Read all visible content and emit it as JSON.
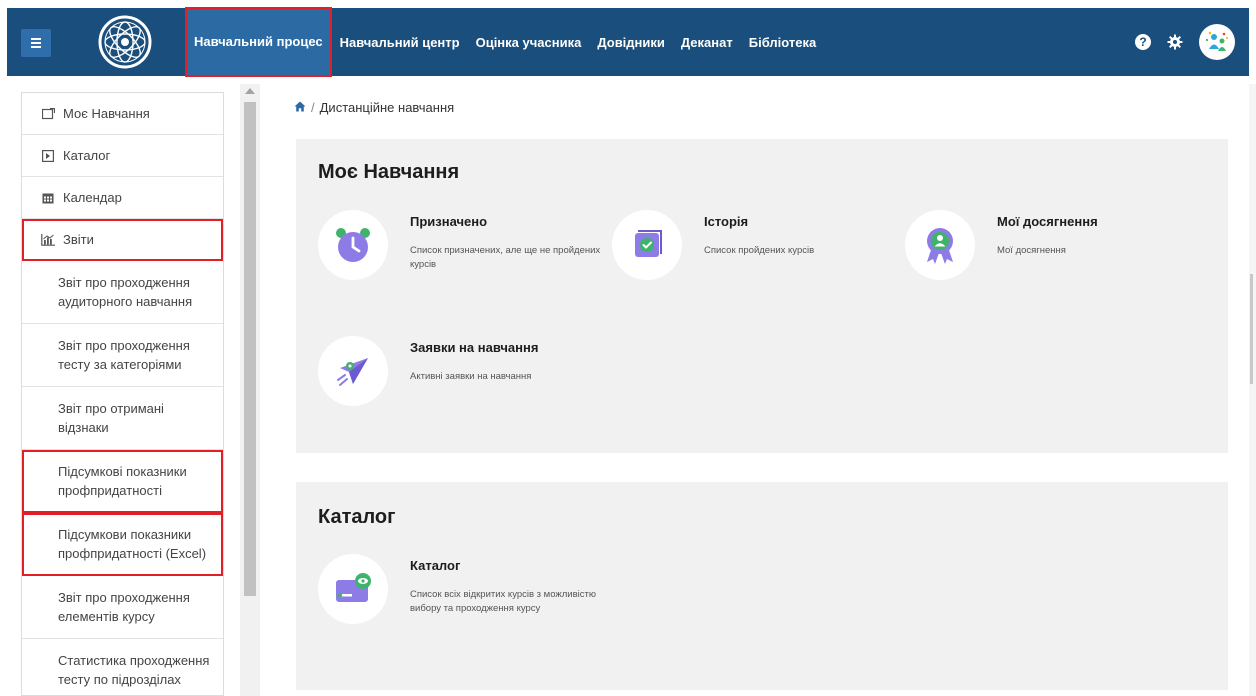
{
  "navbar": {
    "items": [
      {
        "label": "Навчальний процес",
        "active": true
      },
      {
        "label": "Навчальний центр"
      },
      {
        "label": "Оцінка учасника"
      },
      {
        "label": "Довідники"
      },
      {
        "label": "Деканат"
      },
      {
        "label": "Бібліотека"
      }
    ],
    "help_symbol": "?",
    "brand_color": "#1a4e7c",
    "highlight_color": "#e01f26"
  },
  "sidebar": {
    "items": [
      {
        "label": "Моє Навчання",
        "icon": "course-icon"
      },
      {
        "label": "Каталог",
        "icon": "catalog-icon"
      },
      {
        "label": "Календар",
        "icon": "calendar-icon"
      },
      {
        "label": "Звіти",
        "icon": "chart-icon",
        "highlighted": true
      }
    ],
    "subitems": [
      {
        "label": "Звіт про проходження аудиторного навчання"
      },
      {
        "label": "Звіт про проходження тесту за категоріями"
      },
      {
        "label": "Звіт про отримані відзнаки"
      },
      {
        "label": "Підсумкові показники профпридатності",
        "highlighted": true
      },
      {
        "label": "Підсумкови показники профпридатності (Excel)",
        "highlighted": true
      },
      {
        "label": "Звіт про проходження елементів курсу"
      },
      {
        "label": "Статистика проходження тесту по підрозділах"
      }
    ]
  },
  "breadcrumb": {
    "separator": "/",
    "current": "Дистанційне навчання"
  },
  "sections": {
    "my_learning": {
      "title": "Моє Навчання",
      "cards": [
        {
          "title": "Призначено",
          "desc": "Список призначених, але ще не пройдених курсів",
          "icon": "alarm-clock-icon"
        },
        {
          "title": "Історія",
          "desc": "Список пройдених курсів",
          "icon": "checkbox-icon"
        },
        {
          "title": "Мої досягнення",
          "desc": "Мої досягнення",
          "icon": "medal-icon"
        },
        {
          "title": "Заявки на навчання",
          "desc": "Активні заявки на навчання",
          "icon": "paper-plane-icon"
        }
      ]
    },
    "catalog": {
      "title": "Каталог",
      "cards": [
        {
          "title": "Каталог",
          "desc": "Список всіх відкритих курсів з можливістю вибору та проходження курсу",
          "icon": "catalog-eye-icon"
        }
      ]
    }
  }
}
